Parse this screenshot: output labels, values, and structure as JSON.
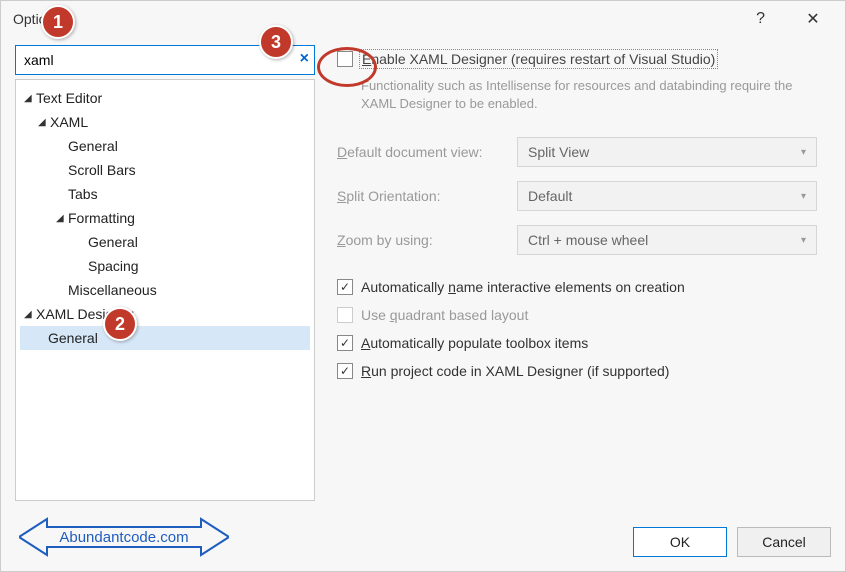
{
  "title": "Options",
  "search": {
    "value": "xaml"
  },
  "tree": {
    "textEditor": "Text Editor",
    "xaml": "XAML",
    "general": "General",
    "scrollBars": "Scroll Bars",
    "tabs": "Tabs",
    "formatting": "Formatting",
    "fmtGeneral": "General",
    "fmtSpacing": "Spacing",
    "miscellaneous": "Miscellaneous",
    "xamlDesigner": "XAML Designer",
    "xdGeneral": "General"
  },
  "right": {
    "enableLabel": "Enable XAML Designer (requires restart of Visual Studio)",
    "desc": "Functionality such as Intellisense for resources and databinding require the XAML Designer to be enabled.",
    "defaultViewLabel": "Default document view:",
    "defaultViewValue": "Split View",
    "splitOrientLabel": "Split Orientation:",
    "splitOrientValue": "Default",
    "zoomLabel": "Zoom by using:",
    "zoomValue": "Ctrl + mouse wheel",
    "autoName": "Automatically name interactive elements on creation",
    "quadrant": "Use quadrant based layout",
    "populate": "Automatically populate toolbox items",
    "runProject": "Run project code in XAML Designer (if supported)"
  },
  "buttons": {
    "ok": "OK",
    "cancel": "Cancel"
  },
  "annotations": {
    "a1": "1",
    "a2": "2",
    "a3": "3"
  },
  "banner": "Abundantcode.com"
}
